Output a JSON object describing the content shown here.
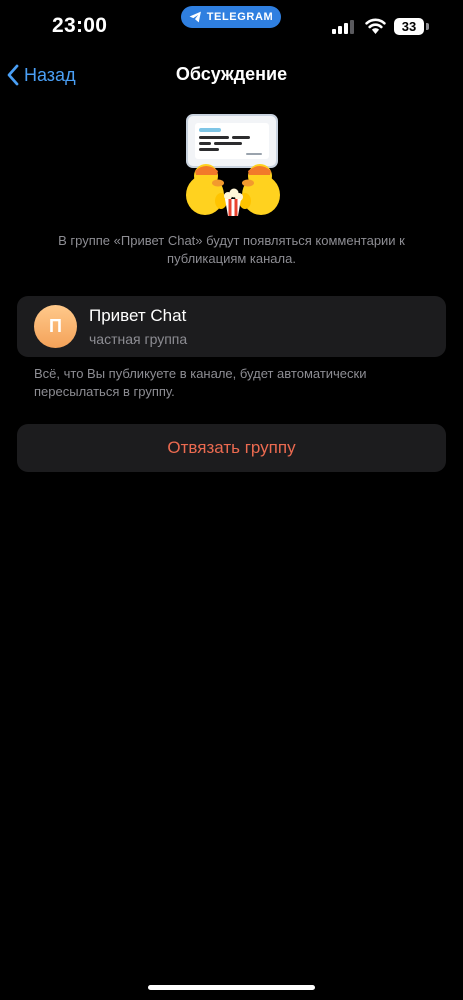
{
  "status_bar": {
    "time": "23:00",
    "app_pill": "TELEGRAM",
    "battery_level": "33"
  },
  "nav": {
    "back_label": "Назад",
    "title": "Обсуждение"
  },
  "intro_text": "В группе «Привет Chat» будут появляться комментарии к публикациям канала.",
  "group": {
    "avatar_letter": "П",
    "name": "Привет Chat",
    "type": "частная группа"
  },
  "info_text": "Всё, что Вы публикуете в канале, будет автоматически пересылаться в группу.",
  "unlink_label": "Отвязать группу",
  "colors": {
    "accent": "#4a9ff5",
    "destructive": "#eb6a50",
    "card_background": "#1c1c1e",
    "secondary_text": "#8d8d93",
    "app_pill": "#2f7fe0"
  },
  "icons": {
    "back": "chevron-left-icon",
    "pill": "telegram-plane-icon",
    "signal": "cellular-signal-icon",
    "wifi": "wifi-icon",
    "illustration": "ducks-watching-screen-sticker"
  }
}
